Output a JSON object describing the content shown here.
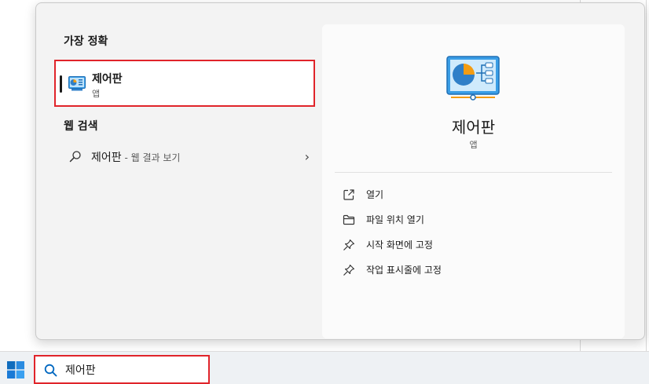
{
  "panel": {
    "best_match_title": "가장 정확",
    "best_match": {
      "name": "제어판",
      "type": "앱",
      "icon": "control-panel-icon"
    },
    "web_search_title": "웹 검색",
    "web_result": {
      "query": "제어판",
      "suffix": " - 웹 결과 보기",
      "icon": "search-icon",
      "chevron": "chevron-right-icon"
    }
  },
  "preview": {
    "name": "제어판",
    "type": "앱",
    "actions": [
      {
        "label": "열기",
        "icon": "open-external-icon"
      },
      {
        "label": "파일 위치 열기",
        "icon": "folder-icon"
      },
      {
        "label": "시작 화면에 고정",
        "icon": "pin-icon"
      },
      {
        "label": "작업 표시줄에 고정",
        "icon": "pin-icon"
      }
    ]
  },
  "taskbar": {
    "search_value": "제어판",
    "start_icon": "windows-logo-icon",
    "search_icon": "search-icon"
  },
  "colors": {
    "highlight_border": "#e0242a",
    "accent_blue": "#0067c0",
    "panel_bg": "#f3f3f3"
  }
}
